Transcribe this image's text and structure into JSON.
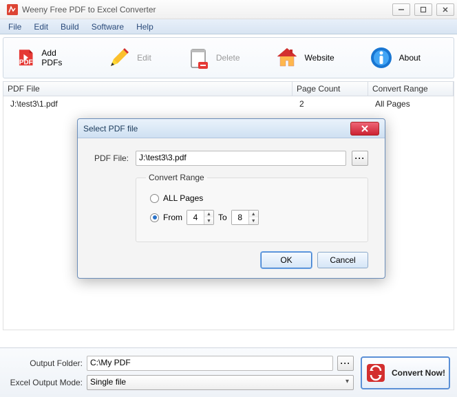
{
  "app": {
    "title": "Weeny Free PDF to Excel Converter"
  },
  "menu": {
    "file": "File",
    "edit": "Edit",
    "build": "Build",
    "software": "Software",
    "help": "Help"
  },
  "toolbar": {
    "add": "Add PDFs",
    "edit": "Edit",
    "delete": "Delete",
    "website": "Website",
    "about": "About"
  },
  "columns": {
    "file": "PDF File",
    "pages": "Page Count",
    "range": "Convert Range"
  },
  "rows": [
    {
      "file": "J:\\test3\\1.pdf",
      "pages": "2",
      "range": "All Pages"
    }
  ],
  "bottom": {
    "outputLabel": "Output Folder:",
    "outputValue": "C:\\My PDF",
    "modeLabel": "Excel Output Mode:",
    "modeValue": "Single file",
    "convert": "Convert Now!"
  },
  "dialog": {
    "title": "Select PDF file",
    "fileLabel": "PDF File:",
    "fileValue": "J:\\test3\\3.pdf",
    "rangeLegend": "Convert Range",
    "allLabel": "ALL Pages",
    "fromLabel": "From",
    "fromValue": "4",
    "toLabel": "To",
    "toValue": "8",
    "ok": "OK",
    "cancel": "Cancel"
  }
}
